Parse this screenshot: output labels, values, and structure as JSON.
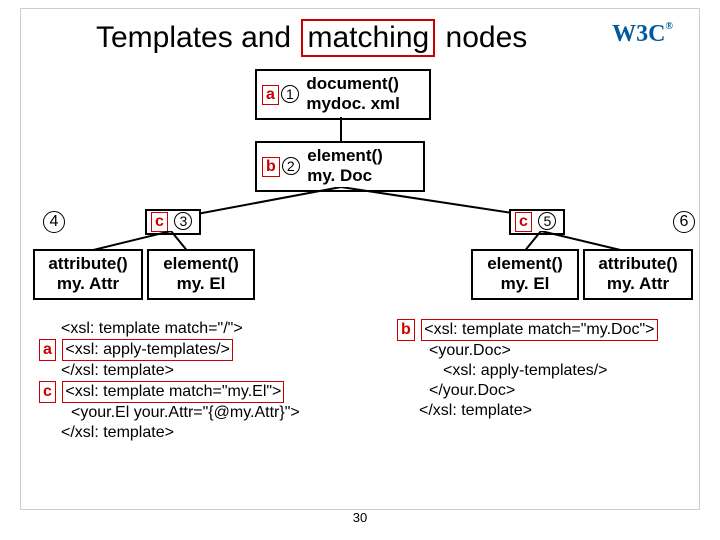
{
  "title": {
    "pre": "Templates and",
    "highlight": "matching",
    "post": "nodes"
  },
  "nodes": {
    "doc": {
      "letter": "a",
      "num": "1",
      "l1": "document()",
      "l2": "mydoc. xml"
    },
    "root": {
      "letter": "b",
      "num": "2",
      "l1": "element()",
      "l2": "my. Doc"
    },
    "c3": {
      "letter": "c",
      "num": "3",
      "l1": "element()",
      "l2": "my. El"
    },
    "c5": {
      "letter": "c",
      "num": "5",
      "l1": "element()",
      "l2": "my. El"
    },
    "attrL": {
      "l1": "attribute()",
      "l2": "my. Attr"
    },
    "attrR": {
      "l1": "attribute()",
      "l2": "my. Attr"
    }
  },
  "circle4": "4",
  "circle6": "6",
  "code_left": {
    "l1": "<xsl: template match=\"/\">",
    "a_letter": "a",
    "l2": "<xsl: apply-templates/>",
    "l3": "</xsl: template>",
    "c_letter": "c",
    "l4": "<xsl: template match=\"my.El\">",
    "l5": "<your.El your.Attr=\"{@my.Attr}\">",
    "l6": "</xsl: template>"
  },
  "code_right": {
    "b_letter": "b",
    "l1": "<xsl: template match=\"my.Doc\">",
    "l2": "<your.Doc>",
    "l3": "<xsl: apply-templates/>",
    "l4": "</your.Doc>",
    "l5": "</xsl: template>"
  },
  "page_number": "30"
}
